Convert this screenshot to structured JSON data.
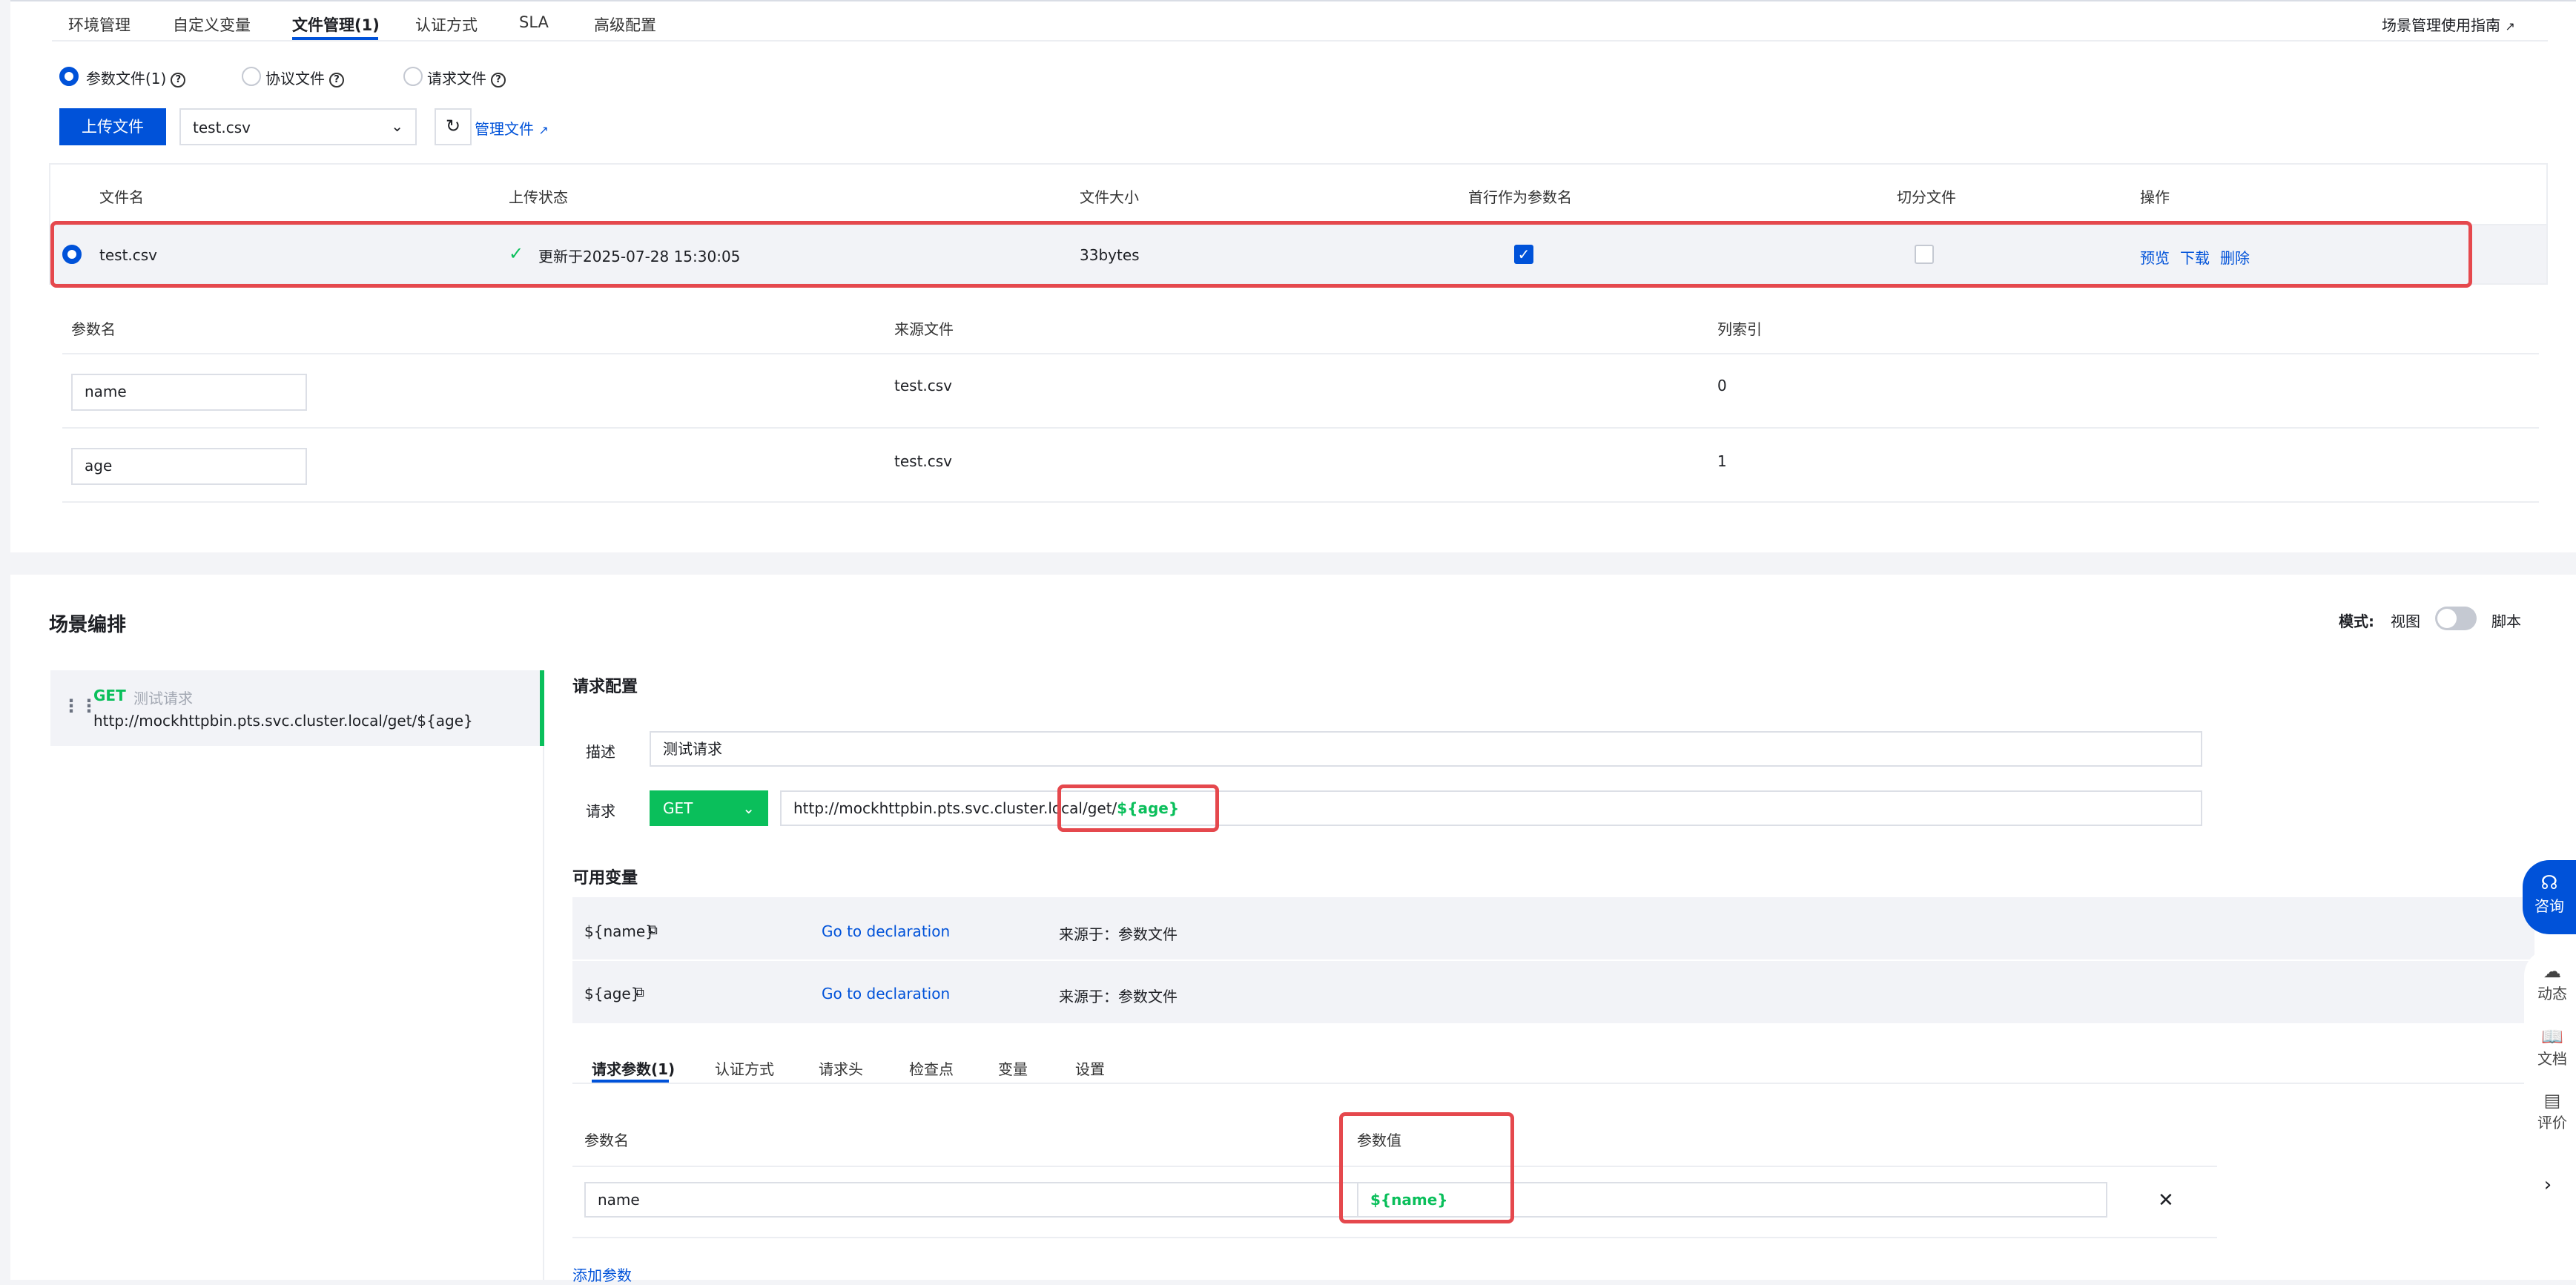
{
  "top_tabs": [
    "环境管理",
    "自定义变量",
    "文件管理(1)",
    "认证方式",
    "SLA",
    "高级配置"
  ],
  "guide_link": "场景管理使用指南",
  "file_types": {
    "param_file": "参数文件(1)",
    "protocol_file": "协议文件",
    "request_file": "请求文件"
  },
  "toolbar": {
    "upload_label": "上传文件",
    "file_select_value": "test.csv",
    "manage_files_label": "管理文件"
  },
  "file_table": {
    "headers": [
      "文件名",
      "上传状态",
      "文件大小",
      "首行作为参数名",
      "切分文件",
      "操作"
    ],
    "row": {
      "name": "test.csv",
      "status": "更新于2025-07-28 15:30:05",
      "size": "33bytes",
      "first_row_as_param": true,
      "split_file": false,
      "actions": [
        "预览",
        "下载",
        "删除"
      ]
    }
  },
  "param_table": {
    "headers": [
      "参数名",
      "来源文件",
      "列索引"
    ],
    "rows": [
      {
        "name": "name",
        "source": "test.csv",
        "index": "0"
      },
      {
        "name": "age",
        "source": "test.csv",
        "index": "1"
      }
    ]
  },
  "scene": {
    "title": "场景编排",
    "mode_label": "模式:",
    "mode_view": "视图",
    "mode_script": "脚本",
    "request_item": {
      "method": "GET",
      "name": "测试请求",
      "url": "http://mockhttpbin.pts.svc.cluster.local/get/${age}"
    }
  },
  "request_config": {
    "title": "请求配置",
    "desc_label": "描述",
    "desc_value": "测试请求",
    "request_label": "请求",
    "method": "GET",
    "url_prefix": "http://mockhttpbin.pts.svc.cluster.local/get/",
    "url_var": "${age}"
  },
  "variables": {
    "title": "可用变量",
    "items": [
      {
        "name": "${name}",
        "link": "Go to declaration",
        "source": "来源于：参数文件"
      },
      {
        "name": "${age}",
        "link": "Go to declaration",
        "source": "来源于：参数文件"
      }
    ]
  },
  "sub_tabs": [
    "请求参数(1)",
    "认证方式",
    "请求头",
    "检查点",
    "变量",
    "设置"
  ],
  "req_params": {
    "headers": [
      "参数名",
      "参数值"
    ],
    "row": {
      "name": "name",
      "value": "${name}"
    },
    "add_label": "添加参数"
  },
  "side_tools": [
    "咨询",
    "动态",
    "文档",
    "评价"
  ],
  "colors": {
    "primary": "#0052d9",
    "success": "#0abf5b",
    "highlight": "#e5484d"
  }
}
